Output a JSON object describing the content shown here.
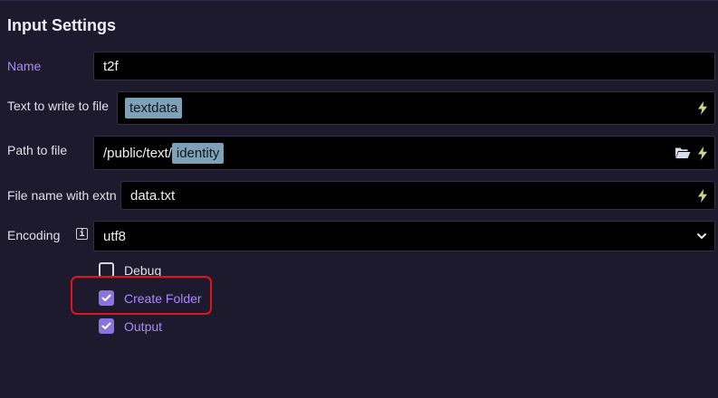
{
  "panel": {
    "title": "Input Settings"
  },
  "fields": {
    "name": {
      "label": "Name",
      "value": "t2f"
    },
    "text_to_write": {
      "label": "Text to write to file",
      "tag": "textdata"
    },
    "path": {
      "label": "Path to file",
      "prefix": "/public/text/",
      "tag": "identity"
    },
    "file_name": {
      "label": "File name with extn",
      "value": "data.txt"
    },
    "encoding": {
      "label": "Encoding",
      "info_glyph": "i",
      "value": "utf8"
    }
  },
  "checkboxes": {
    "debug": {
      "label": "Debug",
      "checked": false
    },
    "create_folder": {
      "label": "Create Folder",
      "checked": true
    },
    "output": {
      "label": "Output",
      "checked": true
    }
  },
  "colors": {
    "background": "#1d1a2e",
    "field_bg": "#000000",
    "accent": "#a78bfa",
    "checkbox_checked": "#8b74e0",
    "variable_tag": "#7fa1b6",
    "bolt_icon": "#c7d68a",
    "highlight_box": "#e0141e"
  },
  "icons": {
    "bolt": "lightning-bolt-icon",
    "folder": "folder-open-icon",
    "chevron": "chevron-down-icon",
    "info": "info-icon",
    "check": "check-icon"
  }
}
